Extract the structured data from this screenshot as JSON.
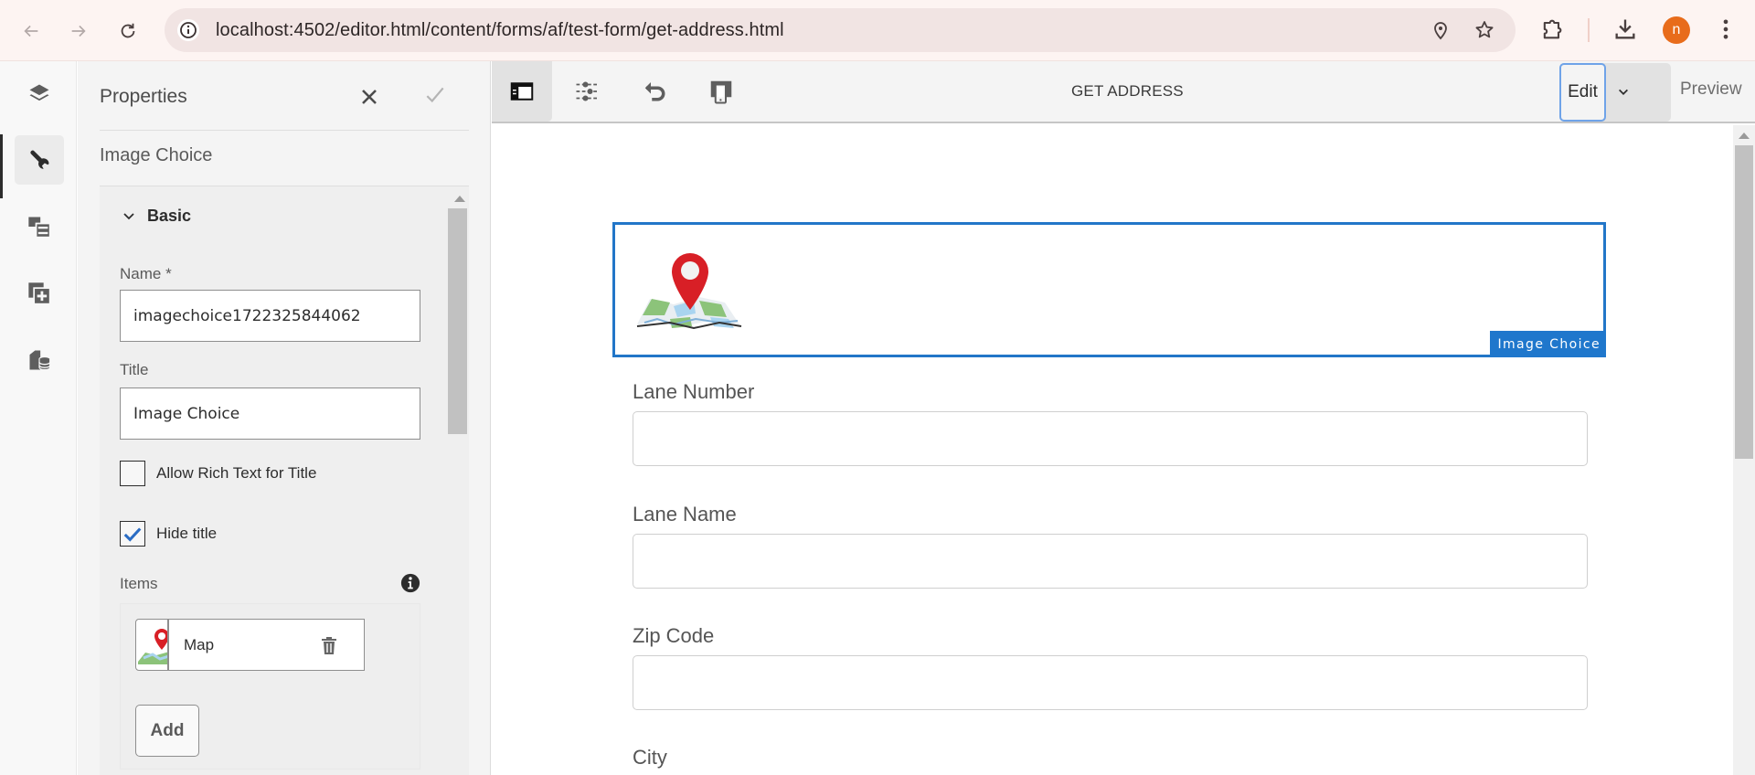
{
  "browser": {
    "url": "localhost:4502/editor.html/content/forms/af/test-form/get-address.html",
    "avatar_initial": "n",
    "avatar_color": "#e86c1b",
    "icons": [
      "back-icon",
      "forward-icon",
      "reload-icon",
      "site-info-icon",
      "location-icon",
      "bookmark-star-icon",
      "extensions-icon",
      "download-icon",
      "more-menu-icon"
    ]
  },
  "rail": {
    "items": [
      {
        "name": "layers",
        "icon": "layers-icon",
        "active": false
      },
      {
        "name": "properties",
        "icon": "wrench-icon",
        "active": true
      },
      {
        "name": "assets",
        "icon": "assets-icon",
        "active": false
      },
      {
        "name": "components",
        "icon": "add-component-icon",
        "active": false
      },
      {
        "name": "data-sources",
        "icon": "data-source-icon",
        "active": false
      }
    ]
  },
  "properties": {
    "title": "Properties",
    "component_type": "Image Choice",
    "section": "Basic",
    "name_label": "Name *",
    "name_value": "imagechoice1722325844062",
    "title_label": "Title",
    "title_value": "Image Choice",
    "allow_rich_text_label": "Allow Rich Text for Title",
    "allow_rich_text_checked": false,
    "hide_title_label": "Hide title",
    "hide_title_checked": true,
    "items_label": "Items",
    "items": [
      {
        "label": "Map"
      }
    ],
    "add_label": "Add"
  },
  "toolbar": {
    "page_title": "GET ADDRESS",
    "edit_label": "Edit",
    "preview_label": "Preview"
  },
  "form": {
    "image_choice_badge": "Image Choice",
    "fields": [
      {
        "label": "Lane Number",
        "value": ""
      },
      {
        "label": "Lane Name",
        "value": ""
      },
      {
        "label": "Zip Code",
        "value": ""
      },
      {
        "label": "City",
        "value": ""
      }
    ]
  },
  "colors": {
    "selection_blue": "#2276c8",
    "badge_blue": "#1f77cc",
    "checkbox_blue": "#2a6cc4",
    "pin_red": "#d81f26"
  }
}
